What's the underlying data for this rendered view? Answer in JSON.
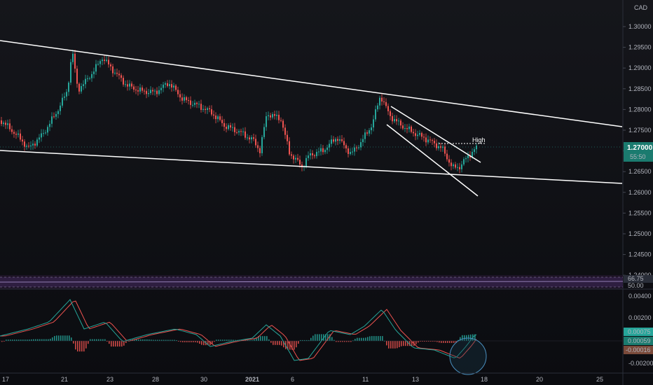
{
  "currency": "CAD",
  "colors": {
    "up": "#26a69a",
    "down": "#ef5350",
    "trendline": "#ffffff",
    "rsi_band": "#7e57c2",
    "price_tag_bg": "#1b7b6f",
    "macd_line": "#26a69a",
    "signal_line": "#ef5350"
  },
  "price_axis": {
    "labels": [
      "1.30000",
      "1.29500",
      "1.29000",
      "1.28500",
      "1.28000",
      "1.27500",
      "1.27000",
      "1.26500",
      "1.26000",
      "1.25500",
      "1.25000",
      "1.24500",
      "1.24000"
    ],
    "current_price": "1.27000",
    "countdown": "55:50"
  },
  "rsi": {
    "value": "66.75",
    "level": "50.00"
  },
  "macd_axis": {
    "labels": [
      "0.00400",
      "0.00200",
      "-0.00200"
    ],
    "macd_value": "0.00075",
    "signal_value": "0.00059",
    "hist_value": "-0.00016"
  },
  "time_axis": {
    "labels": [
      "17",
      "21",
      "23",
      "28",
      "30",
      "2021",
      "6",
      "11",
      "13",
      "18",
      "20",
      "25"
    ]
  },
  "annotation": {
    "high_label": "High"
  }
}
